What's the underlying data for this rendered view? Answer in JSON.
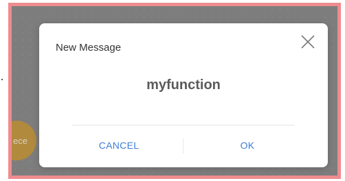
{
  "background": {
    "partial_label": "ece"
  },
  "dialog": {
    "title": "New Message",
    "message": "myfunction",
    "buttons": {
      "cancel": "CANCEL",
      "ok": "OK"
    }
  },
  "icons": {
    "close": "close-icon"
  },
  "colors": {
    "frame_border": "#ef8c8f",
    "overlay": "#7d7d7d",
    "button_text": "#3f7fd6",
    "accent_blob": "#b18a3e"
  }
}
